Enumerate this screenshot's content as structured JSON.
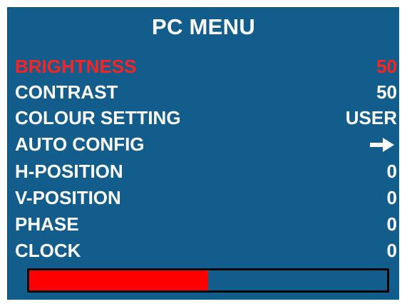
{
  "menu": {
    "title": "PC MENU",
    "items": [
      {
        "label": "BRIGHTNESS",
        "value": "50",
        "selected": true
      },
      {
        "label": "CONTRAST",
        "value": "50",
        "selected": false
      },
      {
        "label": "COLOUR SETTING",
        "value": "USER",
        "selected": false
      },
      {
        "label": "AUTO CONFIG",
        "value": "",
        "icon": "right-arrow-icon",
        "selected": false
      },
      {
        "label": "H-POSITION",
        "value": "0",
        "selected": false
      },
      {
        "label": "V-POSITION",
        "value": "0",
        "selected": false
      },
      {
        "label": "PHASE",
        "value": "0",
        "selected": false
      },
      {
        "label": "CLOCK",
        "value": "0",
        "selected": false
      }
    ]
  },
  "level_bar": {
    "value_percent": 50
  },
  "colors": {
    "panel_background": "#135d8c",
    "text": "#ffffff",
    "selected_text": "#ff2222",
    "bar_fill": "#ff0000",
    "bar_border": "#000000"
  }
}
